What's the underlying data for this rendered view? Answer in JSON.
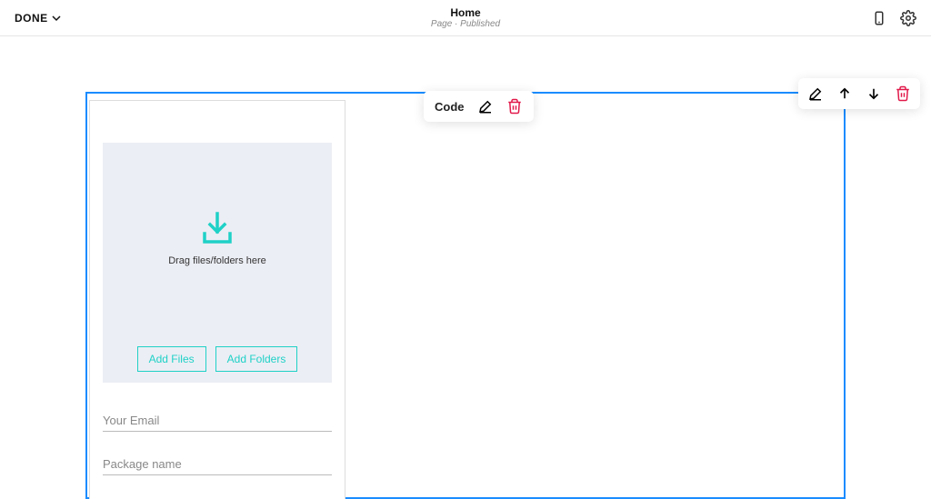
{
  "header": {
    "done_label": "DONE",
    "title": "Home",
    "subtitle": "Page · Published"
  },
  "block_toolbar": {
    "code_label": "Code"
  },
  "dropzone": {
    "drag_text": "Drag files/folders here",
    "add_files_label": "Add Files",
    "add_folders_label": "Add Folders"
  },
  "form": {
    "email_placeholder": "Your Email",
    "package_placeholder": "Package name"
  }
}
